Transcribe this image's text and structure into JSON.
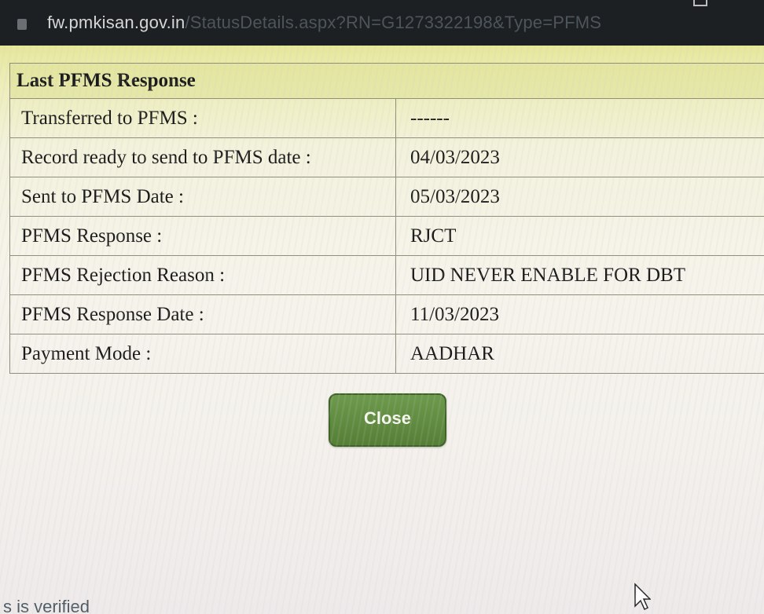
{
  "browser": {
    "url_host": "fw.pmkisan.gov.in",
    "url_path": "/StatusDetails.aspx?RN=G1273322198&Type=PFMS"
  },
  "panel": {
    "title": "Last PFMS Response",
    "rows": [
      {
        "label": "Transferred to PFMS :",
        "value": "------"
      },
      {
        "label": "Record ready to send to PFMS date :",
        "value": "04/03/2023"
      },
      {
        "label": "Sent to PFMS Date :",
        "value": "05/03/2023"
      },
      {
        "label": "PFMS Response :",
        "value": "RJCT"
      },
      {
        "label": "PFMS Rejection Reason :",
        "value": "UID NEVER ENABLE FOR DBT"
      },
      {
        "label": "PFMS Response Date :",
        "value": "11/03/2023"
      },
      {
        "label": "Payment Mode :",
        "value": "AADHAR"
      }
    ],
    "close_label": "Close"
  },
  "background": {
    "partial_text": "s is verified"
  },
  "colors": {
    "close_button": "#5f8c41",
    "panel_header": "#e6e79a"
  }
}
